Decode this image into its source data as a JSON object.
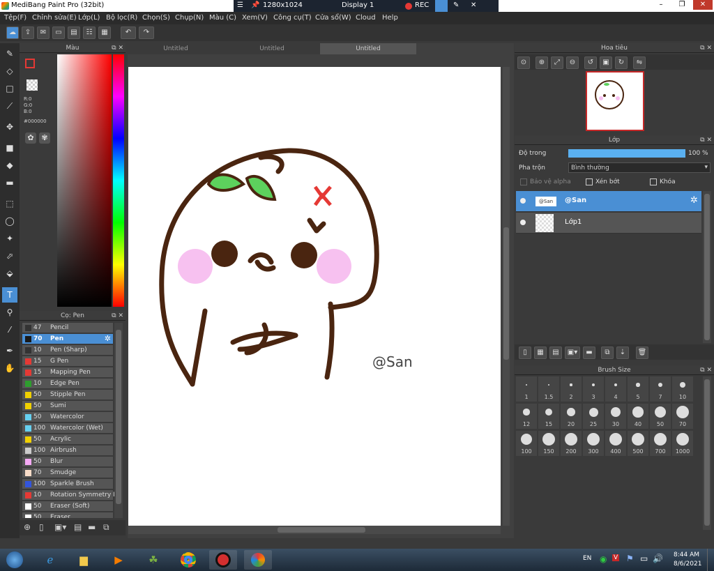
{
  "window": {
    "title": "MediBang Paint Pro (32bit)",
    "min": "–",
    "max": "❐",
    "close": "✕"
  },
  "recorder": {
    "resolution": "1280x1024",
    "display": "Display 1",
    "rec_label": "REC",
    "close": "✕"
  },
  "menu": [
    "Tệp(F)",
    "Chỉnh sửa(E)",
    "Lớp(L)",
    "Bộ lọc(R)",
    "Chọn(S)",
    "Chụp(N)",
    "Màu (C)",
    "Xem(V)",
    "Công cụ(T)",
    "Cửa sổ(W)",
    "Cloud",
    "Help"
  ],
  "color_panel": {
    "title": "Màu",
    "r": "R:0",
    "g": "G:0",
    "b": "B:0",
    "hex": "#000000",
    "primary": "#000000"
  },
  "brush_panel": {
    "title": "Cọ: Pen",
    "brushes": [
      {
        "size": "47",
        "name": "Pencil",
        "color": "#333333"
      },
      {
        "size": "70",
        "name": "Pen",
        "color": "#1a1a1a"
      },
      {
        "size": "10",
        "name": "Pen (Sharp)",
        "color": "#333333"
      },
      {
        "size": "15",
        "name": "G Pen",
        "color": "#e53935"
      },
      {
        "size": "15",
        "name": "Mapping Pen",
        "color": "#e53935"
      },
      {
        "size": "10",
        "name": "Edge Pen",
        "color": "#2e9e2e"
      },
      {
        "size": "50",
        "name": "Stipple Pen",
        "color": "#f0d000"
      },
      {
        "size": "50",
        "name": "Sumi",
        "color": "#f0d000"
      },
      {
        "size": "50",
        "name": "Watercolor",
        "color": "#66d0f0"
      },
      {
        "size": "100",
        "name": "Watercolor (Wet)",
        "color": "#66d0f0"
      },
      {
        "size": "50",
        "name": "Acrylic",
        "color": "#f0d000"
      },
      {
        "size": "100",
        "name": "Airbrush",
        "color": "#cccccc"
      },
      {
        "size": "50",
        "name": "Blur",
        "color": "#f5aaf5"
      },
      {
        "size": "70",
        "name": "Smudge",
        "color": "#f8dcc8"
      },
      {
        "size": "100",
        "name": "Sparkle Brush",
        "color": "#3355dd"
      },
      {
        "size": "10",
        "name": "Rotation Symmetry I",
        "color": "#e53935"
      },
      {
        "size": "50",
        "name": "Eraser (Soft)",
        "color": "#ffffff"
      },
      {
        "size": "50",
        "name": "Eraser",
        "color": "#ffffff"
      }
    ]
  },
  "tabs": [
    "Untitled",
    "Untitled",
    "Untitled"
  ],
  "canvas": {
    "watermark": "@San"
  },
  "navigator": {
    "title": "Hoa tiêu"
  },
  "layers": {
    "title": "Lớp",
    "opacity_label": "Độ trong",
    "opacity_value": "100 %",
    "opacity": 1.0,
    "blend_label": "Pha trộn",
    "blend_value": "Bình thường",
    "protect_alpha": "Bảo vệ alpha",
    "clip": "Xén bớt",
    "lock": "Khóa",
    "items": [
      {
        "name": "@San",
        "thumb": "@San"
      },
      {
        "name": "Lớp1"
      }
    ]
  },
  "brush_size": {
    "title": "Brush Size",
    "sizes": [
      "1",
      "1.5",
      "2",
      "3",
      "4",
      "5",
      "7",
      "10",
      "12",
      "15",
      "20",
      "25",
      "30",
      "40",
      "50",
      "70",
      "100",
      "150",
      "200",
      "300",
      "400",
      "500",
      "700",
      "1000"
    ]
  },
  "taskbar": {
    "lang": "EN",
    "time": "8:44 AM",
    "date": "8/6/2021"
  }
}
